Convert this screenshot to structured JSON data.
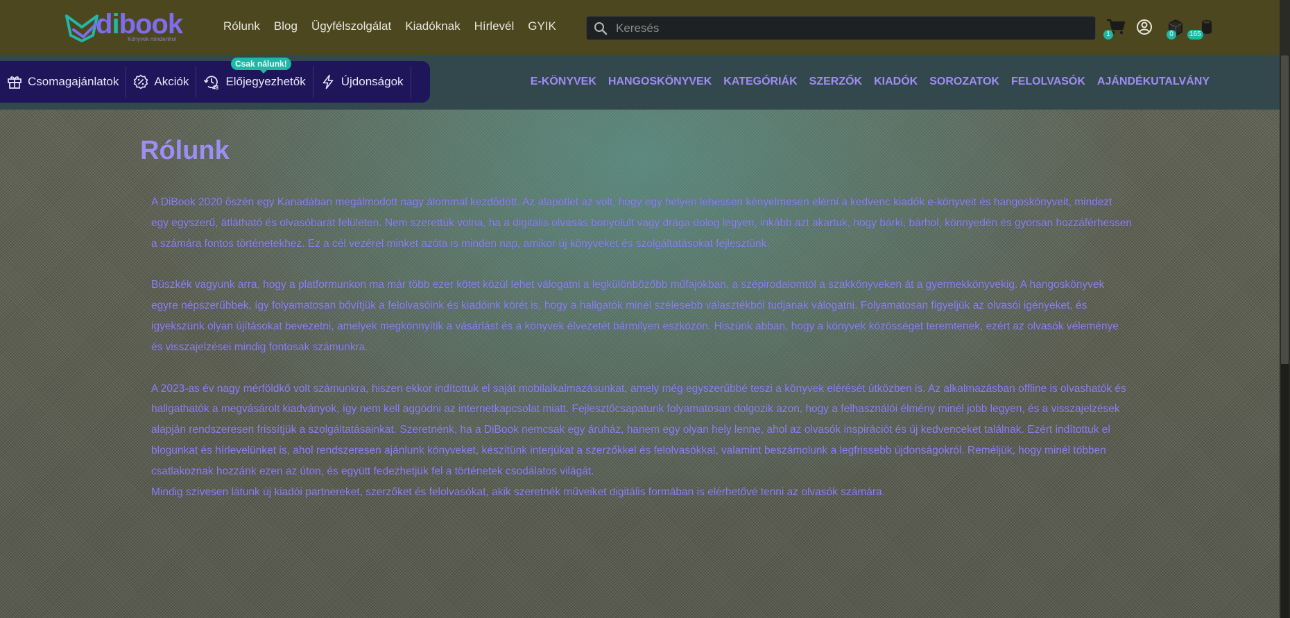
{
  "topbar": {
    "logo": {
      "word": "dibook",
      "word_i": "i",
      "tagline": "Könyvek mindenhol"
    },
    "nav": [
      "Rólunk",
      "Blog",
      "Ügyfélszolgálat",
      "Kiadóknak",
      "Hírlevél",
      "GYIK"
    ],
    "search": {
      "placeholder": "Keresés"
    },
    "icons": [
      "cart-icon",
      "user-icon",
      "box-icon",
      "coins-icon"
    ],
    "badges": {
      "cart": "1",
      "box": "0",
      "coins": "165"
    }
  },
  "subbar": {
    "promo_pill": "Csak nálunk!",
    "promo_items": [
      {
        "label": "Csomagajánlatok",
        "icon": "gift-box-icon"
      },
      {
        "label": "Akciók",
        "icon": "discount-icon"
      },
      {
        "label": "Előjegyezhetők",
        "icon": "preorder-48-icon"
      },
      {
        "label": "Újdonságok",
        "icon": "lightning-icon"
      }
    ],
    "categories": [
      "E-KÖNYVEK",
      "HANGOSKÖNYVEK",
      "KATEGÓRIÁK",
      "SZERZŐK",
      "KIADÓK",
      "SOROZATOK",
      "FELOLVASÓK",
      "AJÁNDÉKUTALVÁNY"
    ]
  },
  "colors": {
    "accent": "#9d8ef5",
    "teal": "#1fb8a5",
    "topbar": "#4c471f",
    "subbar": "#33484c",
    "promo": "#1f155a"
  },
  "main": {
    "title": "Rólunk",
    "paragraphs": [
      "A DiBook 2020 őszén egy Kanadában megálmodott nagy álommal kezdődött. Az alapötlet az volt, hogy egy helyen lehessen kényelmesen elérni a kedvenc kiadók e-könyveit és hangoskönyveit, mindezt egy egyszerű, átlátható és olvasóbarát felületen. Nem szerettük volna, ha a digitális olvasás bonyolult vagy drága dolog legyen, inkább azt akartuk, hogy bárki, bárhol, könnyedén és gyorsan hozzáférhessen a számára fontos történetekhez. Ez a cél vezérel minket azóta is minden nap, amikor új könyveket és szolgáltatásokat fejlesztünk.",
      "Büszkék vagyunk arra, hogy a platformunkon ma már több ezer kötet közül lehet válogatni a legkülönbözőbb műfajokban, a szépirodalomtól a szakkönyveken át a gyermekkönyvekig. A hangoskönyvek egyre népszerűbbek, így folyamatosan bővítjük a felolvasóink és kiadóink körét is, hogy a hallgatók minél szélesebb választékból tudjanak válogatni. Folyamatosan figyeljük az olvasói igényeket, és igyekszünk olyan újításokat bevezetni, amelyek megkönnyítik a vásárlást és a könyvek élvezetét bármilyen eszközön. Hiszünk abban, hogy a könyvek közösséget teremtenek, ezért az olvasók véleménye és visszajelzései mindig fontosak számunkra.",
      "A 2023-as év nagy mérföldkő volt számunkra, hiszen ekkor indítottuk el saját mobilalkalmazásunkat, amely még egyszerűbbé teszi a könyvek elérését útközben is. Az alkalmazásban offline is olvashatók és hallgathatók a megvásárolt kiadványok, így nem kell aggódni az internetkapcsolat miatt. Fejlesztőcsapatunk folyamatosan dolgozik azon, hogy a felhasználói élmény minél jobb legyen, és a visszajelzések alapján rendszeresen frissítjük a szolgáltatásainkat. Szeretnénk, ha a DiBook nemcsak egy áruház, hanem egy olyan hely lenne, ahol az olvasók inspirációt és új kedvenceket találnak. Ezért indítottuk el blogunkat és hírlevelünket is, ahol rendszeresen ajánlunk könyveket, készítünk interjúkat a szerzőkkel és felolvasókkal, valamint beszámolunk a legfrissebb újdonságokról. Reméljük, hogy minél többen csatlakoznak hozzánk ezen az úton, és együtt fedezhetjük fel a történetek csodálatos világát.",
      "Mindig szívesen látunk új kiadói partnereket, szerzőket és felolvasókat, akik szeretnék műveiket digitális formában is elérhetővé tenni az olvasók számára."
    ]
  }
}
